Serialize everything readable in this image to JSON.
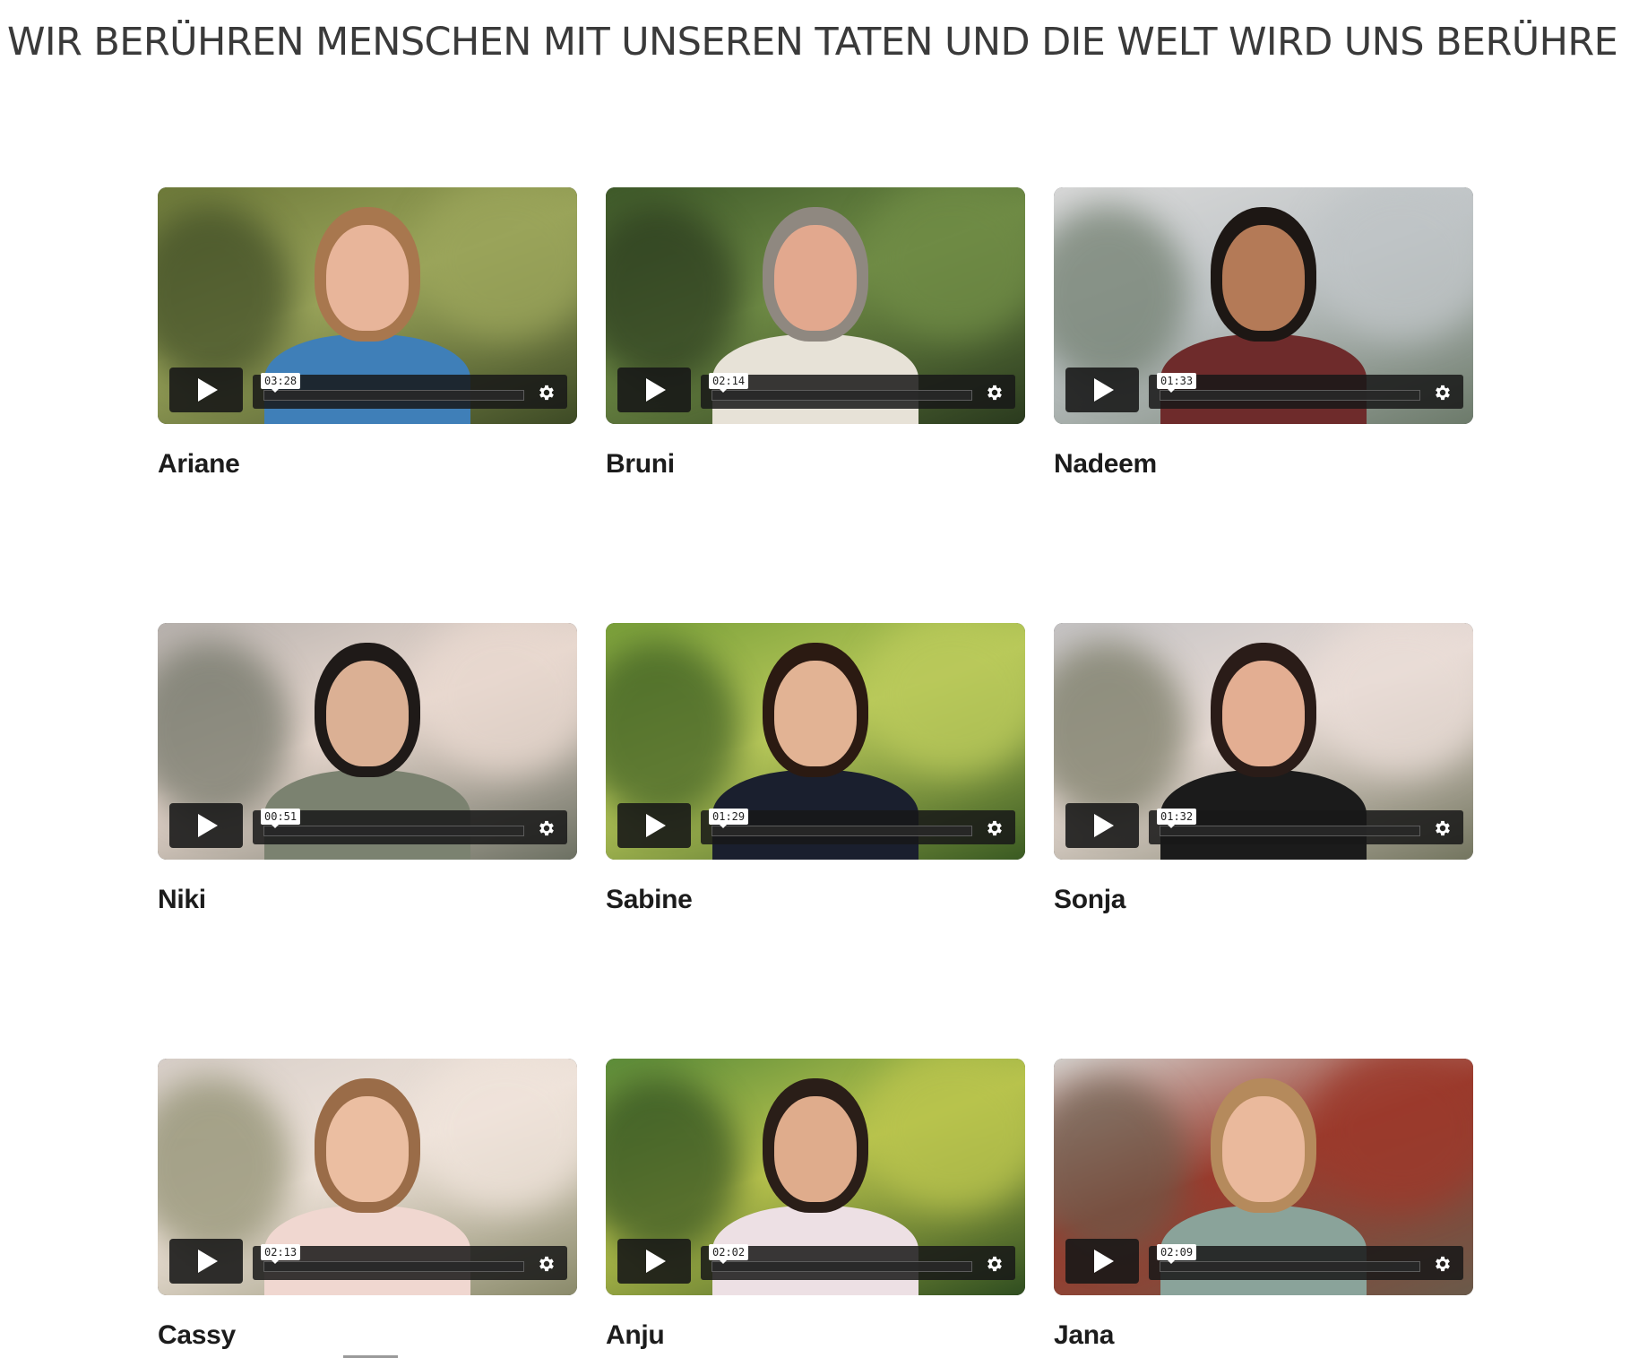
{
  "headline": "WIR BERÜHREN MENSCHEN MIT UNSEREN TATEN UND DIE WELT WIRD UNS BERÜHREN ..",
  "videos": [
    {
      "name": "Ariane",
      "duration": "03:28",
      "bg": [
        "#6e7a3a",
        "#9aa45a",
        "#3d4a25"
      ],
      "skin": "#e8b59a",
      "hair": "#a8774e",
      "shirt": "#3f7fb8"
    },
    {
      "name": "Bruni",
      "duration": "02:14",
      "bg": [
        "#3f5a2a",
        "#6f8b45",
        "#2a3a1e"
      ],
      "skin": "#e2a88e",
      "hair": "#8f8880",
      "shirt": "#e7e2d7"
    },
    {
      "name": "Nadeem",
      "duration": "01:33",
      "bg": [
        "#d9d9d9",
        "#bfc4c6",
        "#6c7a6a"
      ],
      "skin": "#b47a57",
      "hair": "#1d1714",
      "shirt": "#6e2b2b"
    },
    {
      "name": "Niki",
      "duration": "00:51",
      "bg": [
        "#b8b2ae",
        "#e8d8cf",
        "#6c7062"
      ],
      "skin": "#dbb094",
      "hair": "#1f1a18",
      "shirt": "#7b8270"
    },
    {
      "name": "Sabine",
      "duration": "01:29",
      "bg": [
        "#7aa03a",
        "#b9c95a",
        "#3a5a22"
      ],
      "skin": "#e2b394",
      "hair": "#2b1a12",
      "shirt": "#1a1f2e"
    },
    {
      "name": "Sonja",
      "duration": "01:32",
      "bg": [
        "#c5c3c4",
        "#e9dcd6",
        "#73755f"
      ],
      "skin": "#e3ae92",
      "hair": "#2a1c18",
      "shirt": "#1b1b1b"
    },
    {
      "name": "Cassy",
      "duration": "02:13",
      "bg": [
        "#d8cfc9",
        "#efe3da",
        "#8a8a6a"
      ],
      "skin": "#ebbea1",
      "hair": "#9a6c48",
      "shirt": "#f0d7d0"
    },
    {
      "name": "Anju",
      "duration": "02:02",
      "bg": [
        "#5d8d3a",
        "#b8c34d",
        "#2f4d20"
      ],
      "skin": "#dfac8c",
      "hair": "#2a1e18",
      "shirt": "#ede0e4"
    },
    {
      "name": "Jana",
      "duration": "02:09",
      "bg": [
        "#d4d0cc",
        "#9b3a2c",
        "#6a5a4a"
      ],
      "skin": "#eab99c",
      "hair": "#b58a5c",
      "shirt": "#8aa39a"
    }
  ]
}
